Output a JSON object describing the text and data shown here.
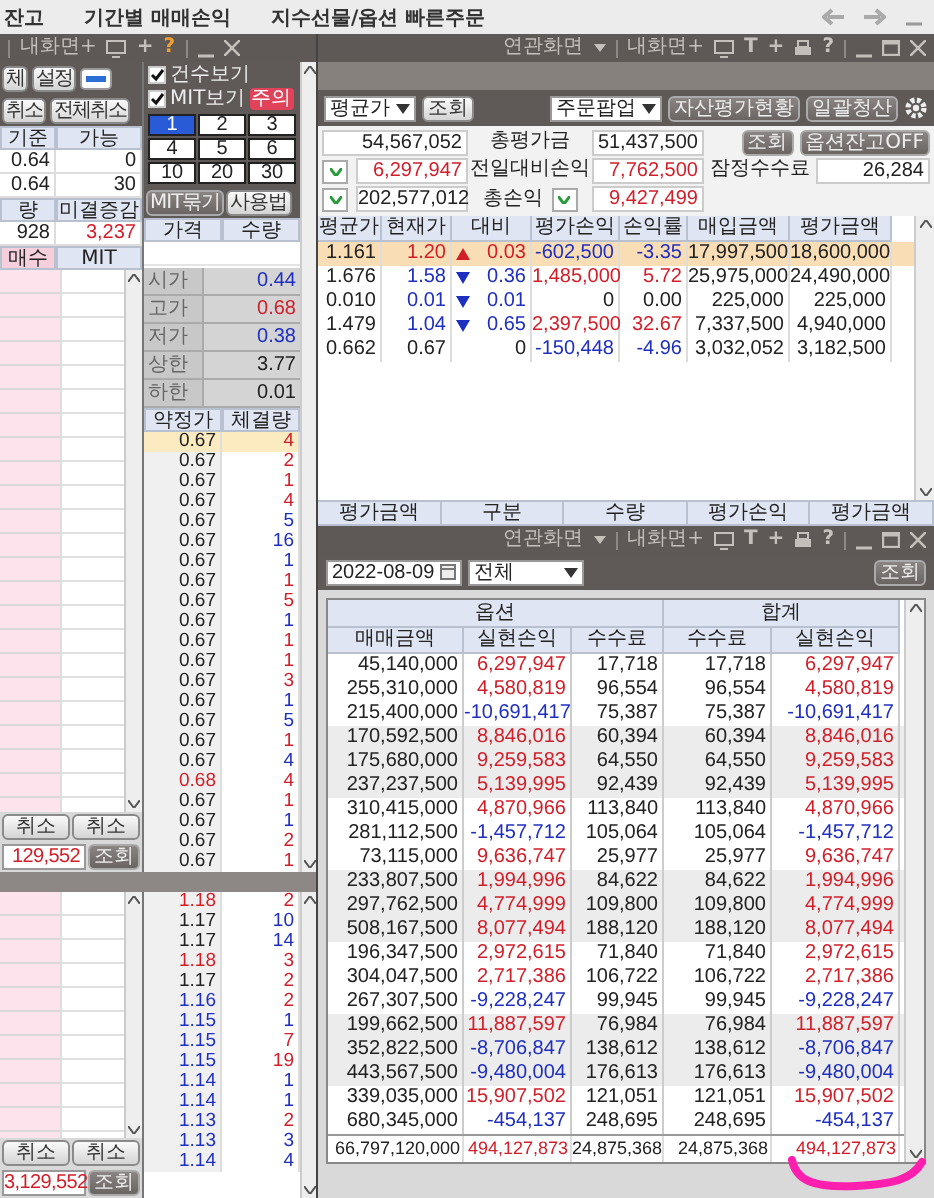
{
  "top_bar": {
    "tabs": [
      "잔고",
      "기간별 매매손익",
      "지수선물/옵션 빠른주문"
    ]
  },
  "left_order_window": {
    "title_bar": {
      "kind": "compact",
      "my_screen": "내화면+",
      "add": "+",
      "help": "?"
    },
    "buttons_row1": [
      "체",
      "설정"
    ],
    "buttons_row2": [
      "취소",
      "전체취소"
    ],
    "position_grid": {
      "header": [
        "기준",
        "가능"
      ],
      "rows": [
        [
          "0.64",
          "0"
        ],
        [
          "0.64",
          "30"
        ]
      ]
    },
    "open_interest": {
      "header": [
        "량",
        "미결증감"
      ],
      "values": [
        {
          "text": "928",
          "color": "#222222"
        },
        {
          "text": "3,237",
          "color": "#d11f2a"
        }
      ]
    },
    "order_header": [
      "매수",
      "MIT"
    ],
    "cancel_buttons": [
      "취소",
      "취소"
    ],
    "total": {
      "value": "129,552",
      "color": "#d11f2a",
      "button": "조회"
    },
    "checkboxes": [
      {
        "label": "건수보기",
        "checked": true
      },
      {
        "label": "MIT보기",
        "checked": true
      }
    ],
    "warning_badge": "주의",
    "quantity_keys": [
      {
        "label": "1",
        "selected": true
      },
      {
        "label": "2",
        "selected": false
      },
      {
        "label": "3",
        "selected": false
      },
      {
        "label": "4",
        "selected": false
      },
      {
        "label": "5",
        "selected": false
      },
      {
        "label": "6",
        "selected": false
      },
      {
        "label": "10",
        "selected": false
      },
      {
        "label": "20",
        "selected": false
      },
      {
        "label": "30",
        "selected": false
      }
    ],
    "mit_buttons": [
      "MIT묶기",
      "사용법"
    ],
    "price_header": [
      "가격",
      "수량"
    ],
    "stats": [
      {
        "label": "시가",
        "value": "0.44",
        "color": "#1f2fbf"
      },
      {
        "label": "고가",
        "value": "0.68",
        "color": "#d11f2a"
      },
      {
        "label": "저가",
        "value": "0.38",
        "color": "#1f2fbf"
      },
      {
        "label": "상한",
        "value": "3.77",
        "color": "#222222"
      },
      {
        "label": "하한",
        "value": "0.01",
        "color": "#222222"
      }
    ],
    "trades_header": [
      "약정가",
      "체결량"
    ],
    "trades": [
      {
        "price": {
          "text": "0.67",
          "color": "#222222"
        },
        "qty": {
          "text": "4",
          "color": "#d11f2a"
        },
        "selected": true
      },
      {
        "price": {
          "text": "0.67",
          "color": "#222222"
        },
        "qty": {
          "text": "2",
          "color": "#d11f2a"
        },
        "selected": false
      },
      {
        "price": {
          "text": "0.67",
          "color": "#222222"
        },
        "qty": {
          "text": "1",
          "color": "#d11f2a"
        },
        "selected": false
      },
      {
        "price": {
          "text": "0.67",
          "color": "#222222"
        },
        "qty": {
          "text": "4",
          "color": "#d11f2a"
        },
        "selected": false
      },
      {
        "price": {
          "text": "0.67",
          "color": "#222222"
        },
        "qty": {
          "text": "5",
          "color": "#1f2fbf"
        },
        "selected": false
      },
      {
        "price": {
          "text": "0.67",
          "color": "#222222"
        },
        "qty": {
          "text": "16",
          "color": "#1f2fbf"
        },
        "selected": false
      },
      {
        "price": {
          "text": "0.67",
          "color": "#222222"
        },
        "qty": {
          "text": "1",
          "color": "#1f2fbf"
        },
        "selected": false
      },
      {
        "price": {
          "text": "0.67",
          "color": "#222222"
        },
        "qty": {
          "text": "1",
          "color": "#d11f2a"
        },
        "selected": false
      },
      {
        "price": {
          "text": "0.67",
          "color": "#222222"
        },
        "qty": {
          "text": "5",
          "color": "#d11f2a"
        },
        "selected": false
      },
      {
        "price": {
          "text": "0.67",
          "color": "#222222"
        },
        "qty": {
          "text": "1",
          "color": "#1f2fbf"
        },
        "selected": false
      },
      {
        "price": {
          "text": "0.67",
          "color": "#222222"
        },
        "qty": {
          "text": "1",
          "color": "#d11f2a"
        },
        "selected": false
      },
      {
        "price": {
          "text": "0.67",
          "color": "#222222"
        },
        "qty": {
          "text": "1",
          "color": "#d11f2a"
        },
        "selected": false
      },
      {
        "price": {
          "text": "0.67",
          "color": "#222222"
        },
        "qty": {
          "text": "3",
          "color": "#d11f2a"
        },
        "selected": false
      },
      {
        "price": {
          "text": "0.67",
          "color": "#222222"
        },
        "qty": {
          "text": "1",
          "color": "#1f2fbf"
        },
        "selected": false
      },
      {
        "price": {
          "text": "0.67",
          "color": "#222222"
        },
        "qty": {
          "text": "5",
          "color": "#1f2fbf"
        },
        "selected": false
      },
      {
        "price": {
          "text": "0.67",
          "color": "#222222"
        },
        "qty": {
          "text": "1",
          "color": "#d11f2a"
        },
        "selected": false
      },
      {
        "price": {
          "text": "0.67",
          "color": "#222222"
        },
        "qty": {
          "text": "4",
          "color": "#1f2fbf"
        },
        "selected": false
      },
      {
        "price": {
          "text": "0.68",
          "color": "#d11f2a"
        },
        "qty": {
          "text": "4",
          "color": "#d11f2a"
        },
        "selected": false
      },
      {
        "price": {
          "text": "0.67",
          "color": "#222222"
        },
        "qty": {
          "text": "1",
          "color": "#d11f2a"
        },
        "selected": false
      },
      {
        "price": {
          "text": "0.67",
          "color": "#222222"
        },
        "qty": {
          "text": "1",
          "color": "#1f2fbf"
        },
        "selected": false
      },
      {
        "price": {
          "text": "0.67",
          "color": "#222222"
        },
        "qty": {
          "text": "2",
          "color": "#d11f2a"
        },
        "selected": false
      },
      {
        "price": {
          "text": "0.67",
          "color": "#222222"
        },
        "qty": {
          "text": "1",
          "color": "#d11f2a"
        },
        "selected": false
      }
    ]
  },
  "left_order_window_2": {
    "cancel_buttons": [
      "취소",
      "취소"
    ],
    "total": {
      "value": "3,129,552",
      "color": "#d11f2a",
      "button": "조회"
    },
    "trades": [
      {
        "price": {
          "text": "1.18",
          "color": "#d11f2a"
        },
        "qty": {
          "text": "2",
          "color": "#d11f2a"
        },
        "selected": false
      },
      {
        "price": {
          "text": "1.17",
          "color": "#222222"
        },
        "qty": {
          "text": "10",
          "color": "#1f2fbf"
        },
        "selected": false
      },
      {
        "price": {
          "text": "1.17",
          "color": "#222222"
        },
        "qty": {
          "text": "14",
          "color": "#1f2fbf"
        },
        "selected": false
      },
      {
        "price": {
          "text": "1.18",
          "color": "#d11f2a"
        },
        "qty": {
          "text": "3",
          "color": "#d11f2a"
        },
        "selected": false
      },
      {
        "price": {
          "text": "1.17",
          "color": "#222222"
        },
        "qty": {
          "text": "2",
          "color": "#d11f2a"
        },
        "selected": false
      },
      {
        "price": {
          "text": "1.16",
          "color": "#1f2fbf"
        },
        "qty": {
          "text": "2",
          "color": "#d11f2a"
        },
        "selected": false
      },
      {
        "price": {
          "text": "1.15",
          "color": "#1f2fbf"
        },
        "qty": {
          "text": "1",
          "color": "#1f2fbf"
        },
        "selected": false
      },
      {
        "price": {
          "text": "1.15",
          "color": "#1f2fbf"
        },
        "qty": {
          "text": "7",
          "color": "#d11f2a"
        },
        "selected": false
      },
      {
        "price": {
          "text": "1.15",
          "color": "#1f2fbf"
        },
        "qty": {
          "text": "19",
          "color": "#d11f2a"
        },
        "selected": false
      },
      {
        "price": {
          "text": "1.14",
          "color": "#1f2fbf"
        },
        "qty": {
          "text": "1",
          "color": "#1f2fbf"
        },
        "selected": false
      },
      {
        "price": {
          "text": "1.14",
          "color": "#1f2fbf"
        },
        "qty": {
          "text": "1",
          "color": "#1f2fbf"
        },
        "selected": false
      },
      {
        "price": {
          "text": "1.13",
          "color": "#1f2fbf"
        },
        "qty": {
          "text": "2",
          "color": "#d11f2a"
        },
        "selected": false
      },
      {
        "price": {
          "text": "1.13",
          "color": "#1f2fbf"
        },
        "qty": {
          "text": "3",
          "color": "#1f2fbf"
        },
        "selected": false
      },
      {
        "price": {
          "text": "1.14",
          "color": "#1f2fbf"
        },
        "qty": {
          "text": "4",
          "color": "#1f2fbf"
        },
        "selected": false
      }
    ]
  },
  "position_window": {
    "title_bar": {
      "kind": "full",
      "related": "연관화면",
      "my_screen": "내화면+",
      "text_tool": "T",
      "add": "+",
      "help": "?"
    },
    "toolbar": {
      "price_basis": "평균가",
      "query": "조회",
      "order_popup": "주문팝업",
      "buttons": [
        "자산평가현황",
        "일괄청산"
      ]
    },
    "summary": {
      "total_buy": "54,567,052",
      "total_eval_label": "총평가금",
      "total_eval": "51,437,500",
      "query": "조회",
      "option_balance": "옵션잔고OFF",
      "realized": {
        "text": "6,297,947",
        "color": "#d11f2a"
      },
      "prev_day_label": "전일대비손익",
      "prev_day": {
        "text": "7,762,500",
        "color": "#d11f2a"
      },
      "fee_label": "잠정수수료",
      "fee": "26,284",
      "principal": "202,577,012",
      "total_pnl_label": "총손익",
      "total_pnl": {
        "text": "9,427,499",
        "color": "#d11f2a"
      }
    },
    "columns": [
      "평균가",
      "현재가",
      "대비",
      "평가손익",
      "손익률",
      "매입금액",
      "평가금액"
    ],
    "rows": [
      {
        "kind": "rise",
        "avg": "1.161",
        "price": {
          "text": "1.20",
          "color": "#d11f2a"
        },
        "change": "0.03",
        "pnl": {
          "text": "-602,500",
          "color": "#1f2fbf"
        },
        "rate": {
          "text": "-3.35",
          "color": "#1f2fbf"
        },
        "buy": "17,997,500",
        "eval": "18,600,000",
        "selected": true
      },
      {
        "kind": "fall",
        "avg": "1.676",
        "price": {
          "text": "1.58",
          "color": "#1f2fbf"
        },
        "change": "0.36",
        "pnl": {
          "text": "1,485,000",
          "color": "#d11f2a"
        },
        "rate": {
          "text": "5.72",
          "color": "#d11f2a"
        },
        "buy": "25,975,000",
        "eval": "24,490,000",
        "selected": false
      },
      {
        "kind": "fall",
        "avg": "0.010",
        "price": {
          "text": "0.01",
          "color": "#1f2fbf"
        },
        "change": "0.01",
        "pnl": {
          "text": "0",
          "color": "#222222"
        },
        "rate": {
          "text": "0.00",
          "color": "#222222"
        },
        "buy": "225,000",
        "eval": "225,000",
        "selected": false
      },
      {
        "kind": "fall",
        "avg": "1.479",
        "price": {
          "text": "1.04",
          "color": "#1f2fbf"
        },
        "change": "0.65",
        "pnl": {
          "text": "2,397,500",
          "color": "#d11f2a"
        },
        "rate": {
          "text": "32.67",
          "color": "#d11f2a"
        },
        "buy": "7,337,500",
        "eval": "4,940,000",
        "selected": false
      },
      {
        "kind": "even",
        "avg": "0.662",
        "price": {
          "text": "0.67",
          "color": "#222222"
        },
        "change": "0",
        "pnl": {
          "text": "-150,448",
          "color": "#1f2fbf"
        },
        "rate": {
          "text": "-4.96",
          "color": "#1f2fbf"
        },
        "buy": "3,032,052",
        "eval": "3,182,500",
        "selected": false
      }
    ],
    "footer_columns": [
      "평가금액",
      "구분",
      "수량",
      "평가손익",
      "평가금액"
    ]
  },
  "pnl_window": {
    "title_bar": {
      "kind": "full",
      "related": "연관화면",
      "my_screen": "내화면+",
      "text_tool": "T",
      "add": "+",
      "help": "?"
    },
    "date": "2022-08-09",
    "filter": "전체",
    "query": "조회",
    "groups": [
      "옵션",
      "합계"
    ],
    "columns": [
      "매매금액",
      "실현손익",
      "수수료",
      "수수료",
      "실현손익"
    ],
    "rows": [
      {
        "cells": [
          "45,140,000",
          "6,297,947",
          "17,718",
          "17,718",
          "6,297,947"
        ],
        "color": "#d11f2a"
      },
      {
        "cells": [
          "255,310,000",
          "4,580,819",
          "96,554",
          "96,554",
          "4,580,819"
        ],
        "color": "#d11f2a"
      },
      {
        "cells": [
          "215,400,000",
          "-10,691,417",
          "75,387",
          "75,387",
          "-10,691,417"
        ],
        "color": "#1f2fbf"
      },
      {
        "cells": [
          "170,592,500",
          "8,846,016",
          "60,394",
          "60,394",
          "8,846,016"
        ],
        "color": "#d11f2a"
      },
      {
        "cells": [
          "175,680,000",
          "9,259,583",
          "64,550",
          "64,550",
          "9,259,583"
        ],
        "color": "#d11f2a"
      },
      {
        "cells": [
          "237,237,500",
          "5,139,995",
          "92,439",
          "92,439",
          "5,139,995"
        ],
        "color": "#d11f2a"
      },
      {
        "cells": [
          "310,415,000",
          "4,870,966",
          "113,840",
          "113,840",
          "4,870,966"
        ],
        "color": "#d11f2a"
      },
      {
        "cells": [
          "281,112,500",
          "-1,457,712",
          "105,064",
          "105,064",
          "-1,457,712"
        ],
        "color": "#1f2fbf"
      },
      {
        "cells": [
          "73,115,000",
          "9,636,747",
          "25,977",
          "25,977",
          "9,636,747"
        ],
        "color": "#d11f2a"
      },
      {
        "cells": [
          "233,807,500",
          "1,994,996",
          "84,622",
          "84,622",
          "1,994,996"
        ],
        "color": "#d11f2a"
      },
      {
        "cells": [
          "297,762,500",
          "4,774,999",
          "109,800",
          "109,800",
          "4,774,999"
        ],
        "color": "#d11f2a"
      },
      {
        "cells": [
          "508,167,500",
          "8,077,494",
          "188,120",
          "188,120",
          "8,077,494"
        ],
        "color": "#d11f2a"
      },
      {
        "cells": [
          "196,347,500",
          "2,972,615",
          "71,840",
          "71,840",
          "2,972,615"
        ],
        "color": "#d11f2a"
      },
      {
        "cells": [
          "304,047,500",
          "2,717,386",
          "106,722",
          "106,722",
          "2,717,386"
        ],
        "color": "#d11f2a"
      },
      {
        "cells": [
          "267,307,500",
          "-9,228,247",
          "99,945",
          "99,945",
          "-9,228,247"
        ],
        "color": "#1f2fbf"
      },
      {
        "cells": [
          "199,662,500",
          "11,887,597",
          "76,984",
          "76,984",
          "11,887,597"
        ],
        "color": "#d11f2a"
      },
      {
        "cells": [
          "352,822,500",
          "-8,706,847",
          "138,612",
          "138,612",
          "-8,706,847"
        ],
        "color": "#1f2fbf"
      },
      {
        "cells": [
          "443,567,500",
          "-9,480,004",
          "176,613",
          "176,613",
          "-9,480,004"
        ],
        "color": "#1f2fbf"
      },
      {
        "cells": [
          "339,035,000",
          "15,907,502",
          "121,051",
          "121,051",
          "15,907,502"
        ],
        "color": "#d11f2a"
      },
      {
        "cells": [
          "680,345,000",
          "-454,137",
          "248,695",
          "248,695",
          "-454,137"
        ],
        "color": "#1f2fbf"
      }
    ],
    "total": {
      "cells": [
        "66,797,120,000",
        "494,127,873",
        "24,875,368",
        "24,875,368",
        "494,127,873"
      ],
      "color": "#d11f2a"
    }
  }
}
